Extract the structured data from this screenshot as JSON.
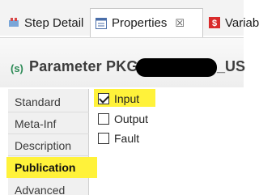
{
  "tabs": [
    {
      "label": "Step Detail",
      "icon": "step-detail-icon"
    },
    {
      "label": "Properties",
      "icon": "properties-icon",
      "close": "☒"
    },
    {
      "label": "Variabl",
      "icon": "variables-icon"
    }
  ],
  "header": {
    "icon_text": "(s)",
    "title": "Parameter PKG_",
    "title_tail": "_US"
  },
  "nav": {
    "items": [
      {
        "label": "Standard"
      },
      {
        "label": "Meta-Inf"
      },
      {
        "label": "Description"
      },
      {
        "label": "Publication"
      },
      {
        "label": "Advanced"
      }
    ]
  },
  "options": [
    {
      "label": "Input",
      "checked": true
    },
    {
      "label": "Output",
      "checked": false
    },
    {
      "label": "Fault",
      "checked": false
    }
  ],
  "colors": {
    "highlight": "#fff23a",
    "redaction": "#000000"
  }
}
